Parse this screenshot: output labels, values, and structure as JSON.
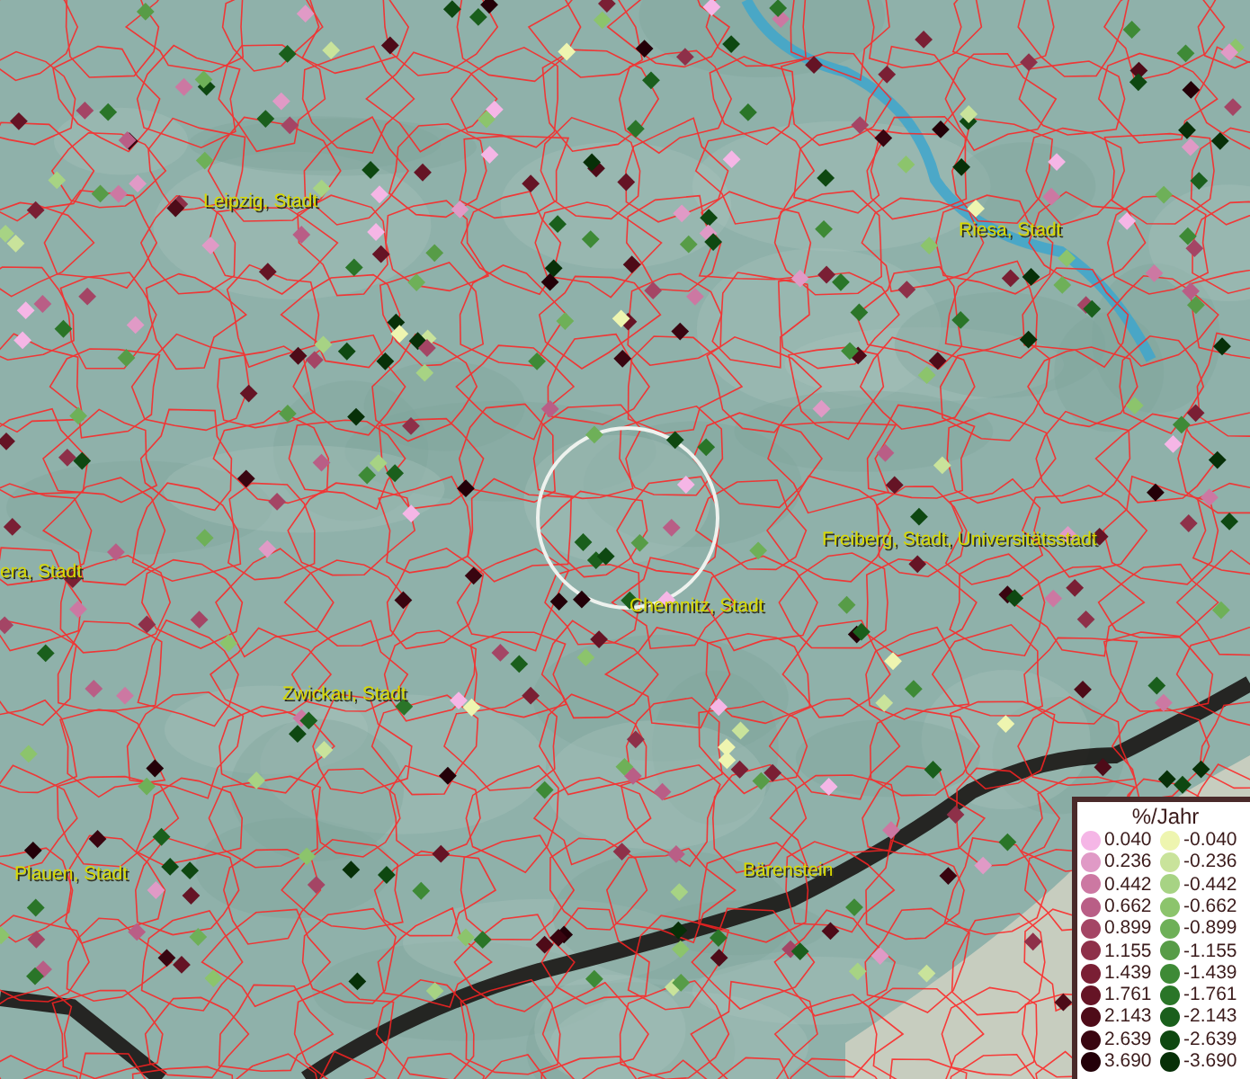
{
  "map": {
    "place_labels": [
      {
        "text": "Leipzig, Stadt"
      },
      {
        "text": "Riesa, Stadt"
      },
      {
        "text": "era, Stadt"
      },
      {
        "text": "Freiberg, Stadt, Universitätsstadt"
      },
      {
        "text": "Chemnitz, Stadt"
      },
      {
        "text": "Zwickau, Stadt"
      },
      {
        "text": "Plauen, Stadt"
      },
      {
        "text": "Bärenstein"
      }
    ]
  },
  "legend": {
    "title": "%/Jahr",
    "columns": [
      [
        {
          "value": "0.040",
          "color": "#f5b6e6"
        },
        {
          "value": "0.236",
          "color": "#e09ac6"
        },
        {
          "value": "0.442",
          "color": "#cc78a2"
        },
        {
          "value": "0.662",
          "color": "#b95e86"
        },
        {
          "value": "0.899",
          "color": "#a44565"
        },
        {
          "value": "1.155",
          "color": "#8e3049"
        },
        {
          "value": "1.439",
          "color": "#7a1f34"
        },
        {
          "value": "1.761",
          "color": "#651425"
        },
        {
          "value": "2.143",
          "color": "#4e0b18"
        },
        {
          "value": "2.639",
          "color": "#390510"
        },
        {
          "value": "3.690",
          "color": "#230008"
        }
      ],
      [
        {
          "value": "-0.040",
          "color": "#eef5b0"
        },
        {
          "value": "-0.236",
          "color": "#c9e39b"
        },
        {
          "value": "-0.442",
          "color": "#a7d384"
        },
        {
          "value": "-0.662",
          "color": "#8cc46c"
        },
        {
          "value": "-0.899",
          "color": "#6eb058"
        },
        {
          "value": "-1.155",
          "color": "#579c47"
        },
        {
          "value": "-1.439",
          "color": "#3e8a36"
        },
        {
          "value": "-1.761",
          "color": "#2a7528"
        },
        {
          "value": "-2.143",
          "color": "#1a5f1c"
        },
        {
          "value": "-2.639",
          "color": "#0e4811"
        },
        {
          "value": "-3.690",
          "color": "#073008"
        }
      ]
    ]
  }
}
